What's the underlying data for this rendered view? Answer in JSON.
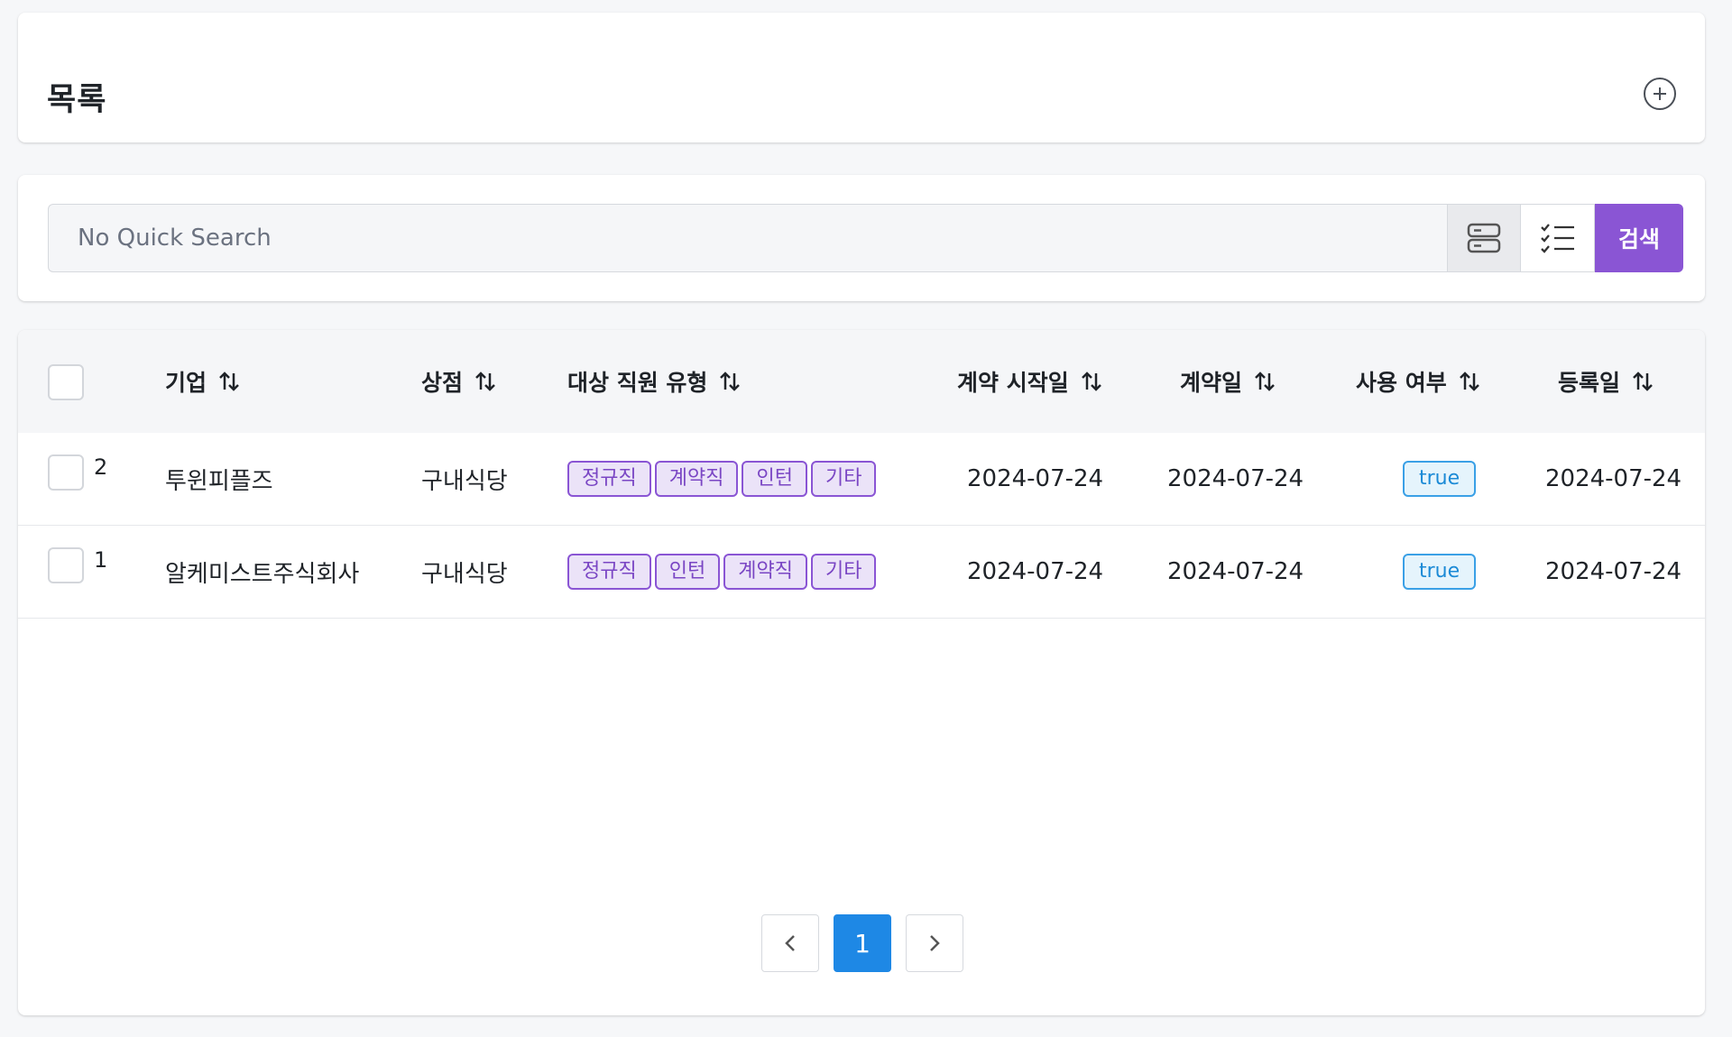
{
  "header": {
    "title": "목록",
    "add_icon": "plus-circle-icon"
  },
  "search": {
    "placeholder": "No Quick Search",
    "value": "",
    "filter_icon": "filter-fields-icon",
    "checklist_icon": "checklist-icon",
    "search_label": "검색",
    "accent": "#8a55d4"
  },
  "table": {
    "columns": [
      "기업",
      "상점",
      "대상 직원 유형",
      "계약 시작일",
      "계약일",
      "사용 여부",
      "등록일"
    ],
    "rows": [
      {
        "id": "2",
        "company": "투윈피플즈",
        "store": "구내식당",
        "types": [
          "정규직",
          "계약직",
          "인턴",
          "기타"
        ],
        "contract_start": "2024-07-24",
        "contract_date": "2024-07-24",
        "in_use": "true",
        "registered": "2024-07-24"
      },
      {
        "id": "1",
        "company": "알케미스트주식회사",
        "store": "구내식당",
        "types": [
          "정규직",
          "인턴",
          "계약직",
          "기타"
        ],
        "contract_start": "2024-07-24",
        "contract_date": "2024-07-24",
        "in_use": "true",
        "registered": "2024-07-24"
      }
    ]
  },
  "pagination": {
    "current": "1",
    "prev_icon": "chevron-left-icon",
    "next_icon": "chevron-right-icon",
    "active_color": "#1e88e5"
  }
}
